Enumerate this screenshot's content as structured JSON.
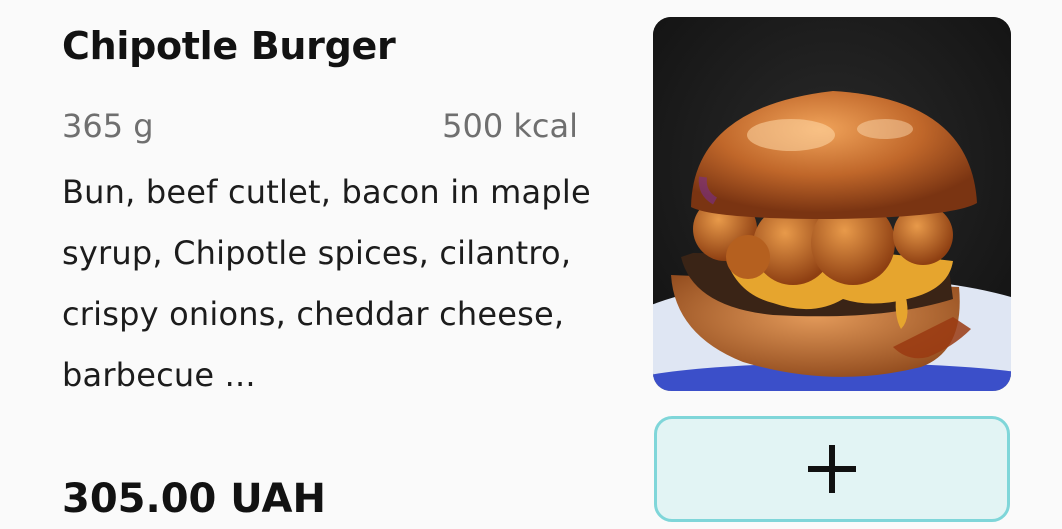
{
  "product": {
    "name": "Chipotle Burger",
    "weight": "365 g",
    "calories": "500 kcal",
    "description": "Bun, beef cutlet, bacon in maple syrup, Chipotle spices, cilantro, crispy onions, cheddar cheese, barbecue ...",
    "price": "305.00 UAH"
  },
  "image": {
    "subject": "burger",
    "background_color": "#161616",
    "plate_color": "#3b4fc9"
  },
  "add_button": {
    "icon": "plus-icon",
    "border_color": "#7fd6d9",
    "fill_color": "#e2f4f4"
  }
}
